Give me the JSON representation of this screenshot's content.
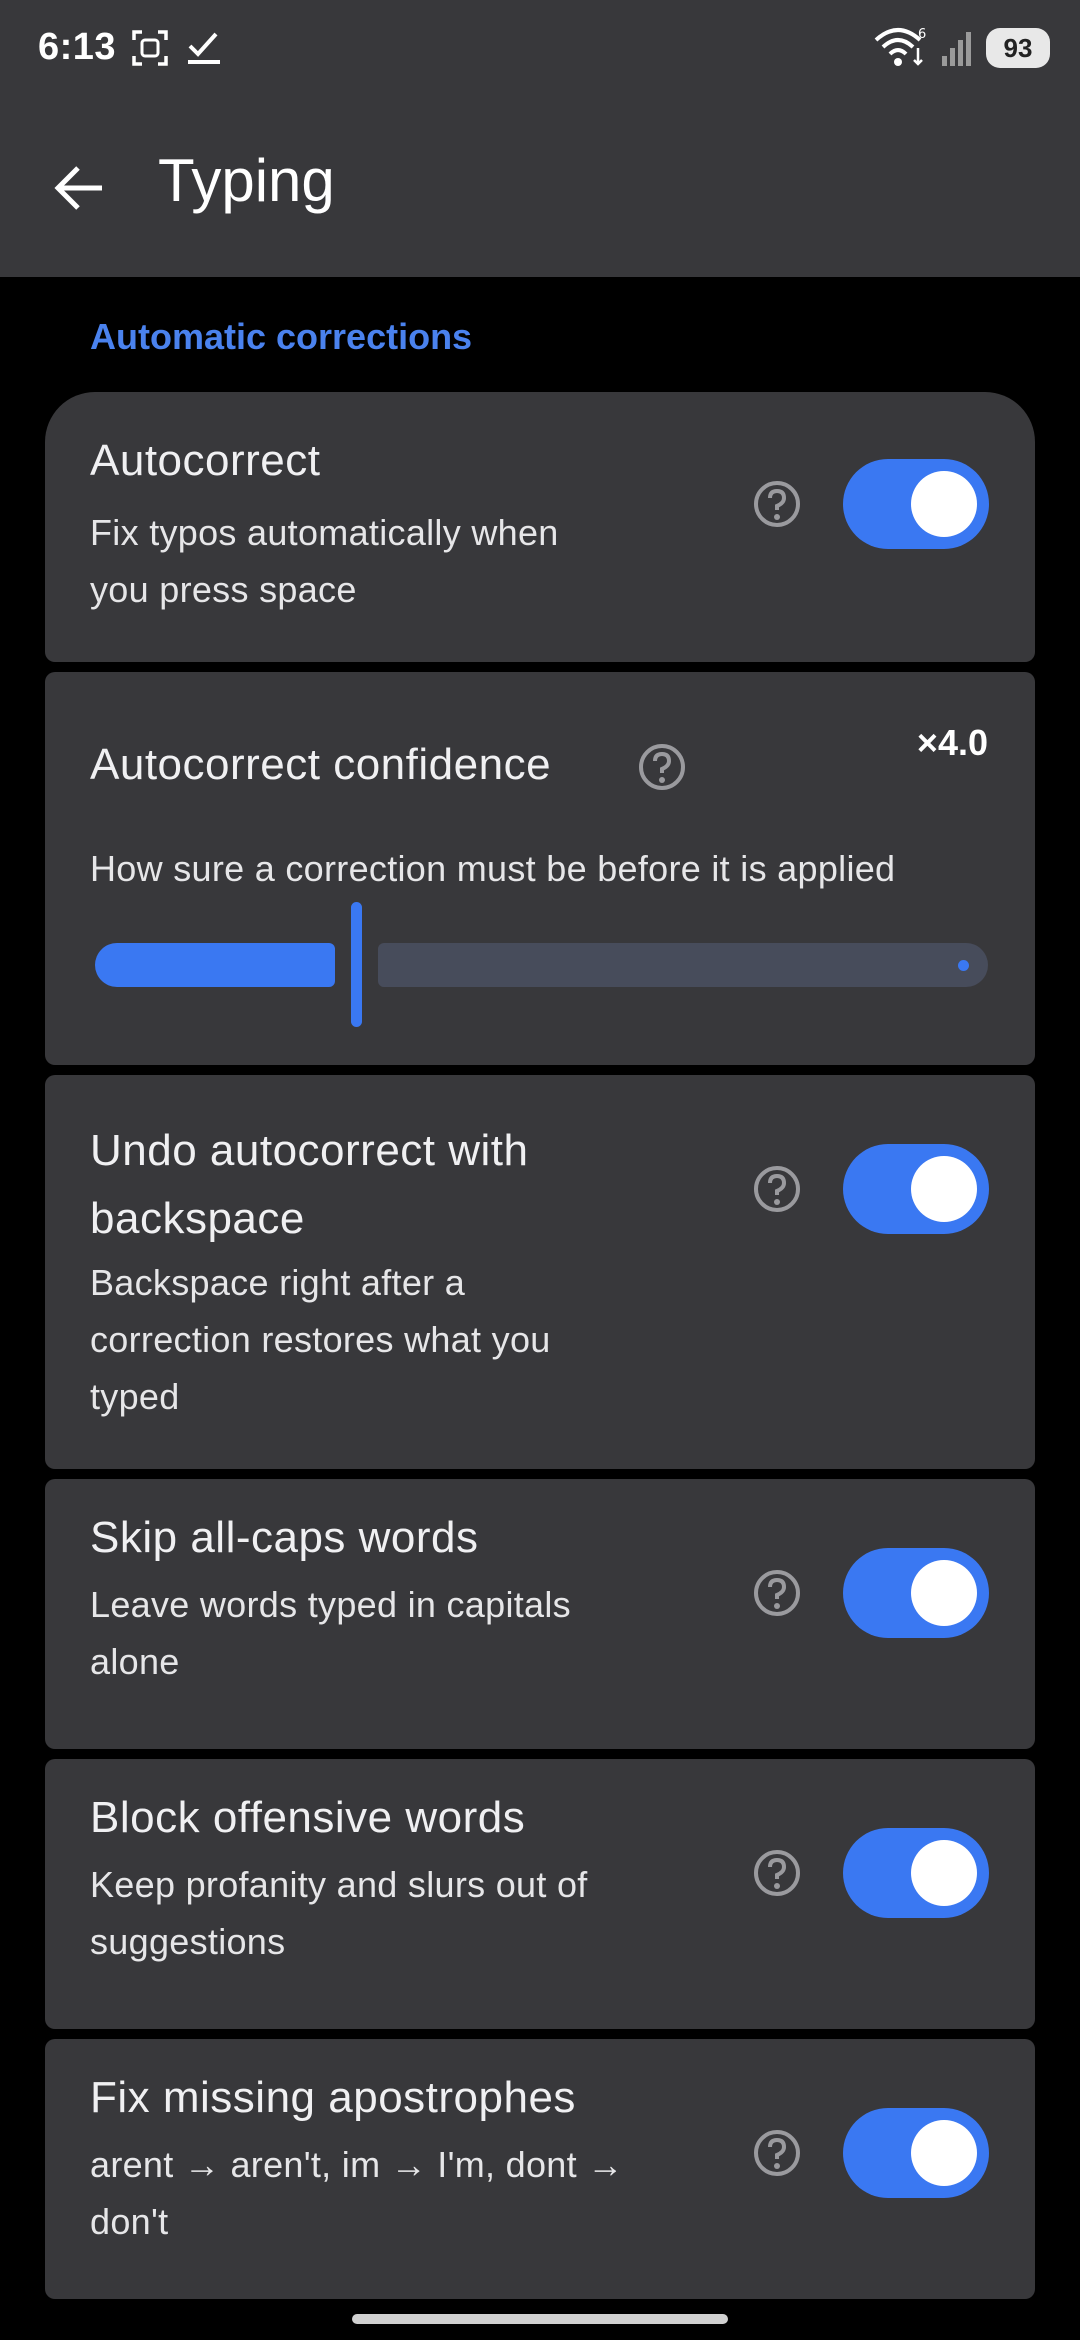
{
  "status_bar": {
    "time": "6:13",
    "battery": "93",
    "wifi_badge": "6"
  },
  "app_bar": {
    "title": "Typing"
  },
  "section": {
    "header": "Automatic corrections"
  },
  "settings": {
    "autocorrect": {
      "title": "Autocorrect",
      "line1": "Fix typos automatically when",
      "line2": "you press space",
      "enabled": true
    },
    "confidence": {
      "title": "Autocorrect confidence",
      "value_label": "×4.0",
      "description": "How sure a correction must be before it is applied",
      "level_fraction": 0.3
    },
    "undo": {
      "title_line1": "Undo autocorrect with",
      "title_line2": "backspace",
      "line1": "Backspace right after a",
      "line2": "correction restores what you",
      "line3": "typed",
      "enabled": true
    },
    "allcaps": {
      "title": "Skip all-caps words",
      "line1": "Leave words typed in capitals",
      "line2": "alone",
      "enabled": true
    },
    "offensive": {
      "title": "Block offensive words",
      "line1": "Keep profanity and slurs out of",
      "line2": "suggestions",
      "enabled": true
    },
    "apostrophes": {
      "title": "Fix missing apostrophes",
      "line1": "arent → aren't, im → I'm, dont →",
      "line2": "don't",
      "enabled": true
    }
  },
  "colors": {
    "accent": "#3a78f2",
    "section_header": "#4a82ee",
    "card": "#38383b",
    "background": "#000000"
  }
}
